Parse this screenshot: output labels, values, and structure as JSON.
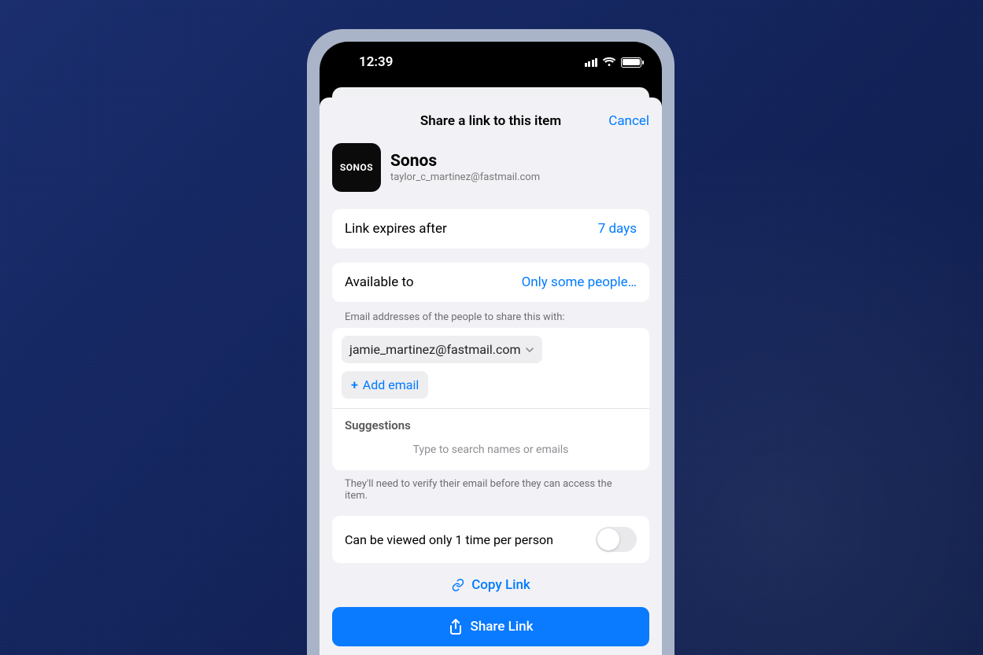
{
  "statusbar": {
    "time": "12:39"
  },
  "sheet": {
    "title": "Share a link to this item",
    "cancel": "Cancel"
  },
  "item": {
    "icon_label": "SONOS",
    "name": "Sonos",
    "subtitle": "taylor_c_martinez@fastmail.com"
  },
  "expiry": {
    "label": "Link expires after",
    "value": "7 days"
  },
  "availability": {
    "label": "Available to",
    "value": "Only some people…"
  },
  "emails": {
    "caption": "Email addresses of the people to share this with:",
    "recipients": [
      {
        "email": "jamie_martinez@fastmail.com"
      }
    ],
    "add_label": "Add email",
    "suggestions_label": "Suggestions",
    "suggestions_placeholder": "Type to search names or emails",
    "footnote": "They'll need to verify their email before they can access the item."
  },
  "single_view": {
    "label": "Can be viewed only 1 time per person",
    "enabled": false
  },
  "actions": {
    "copy": "Copy Link",
    "share": "Share Link"
  }
}
